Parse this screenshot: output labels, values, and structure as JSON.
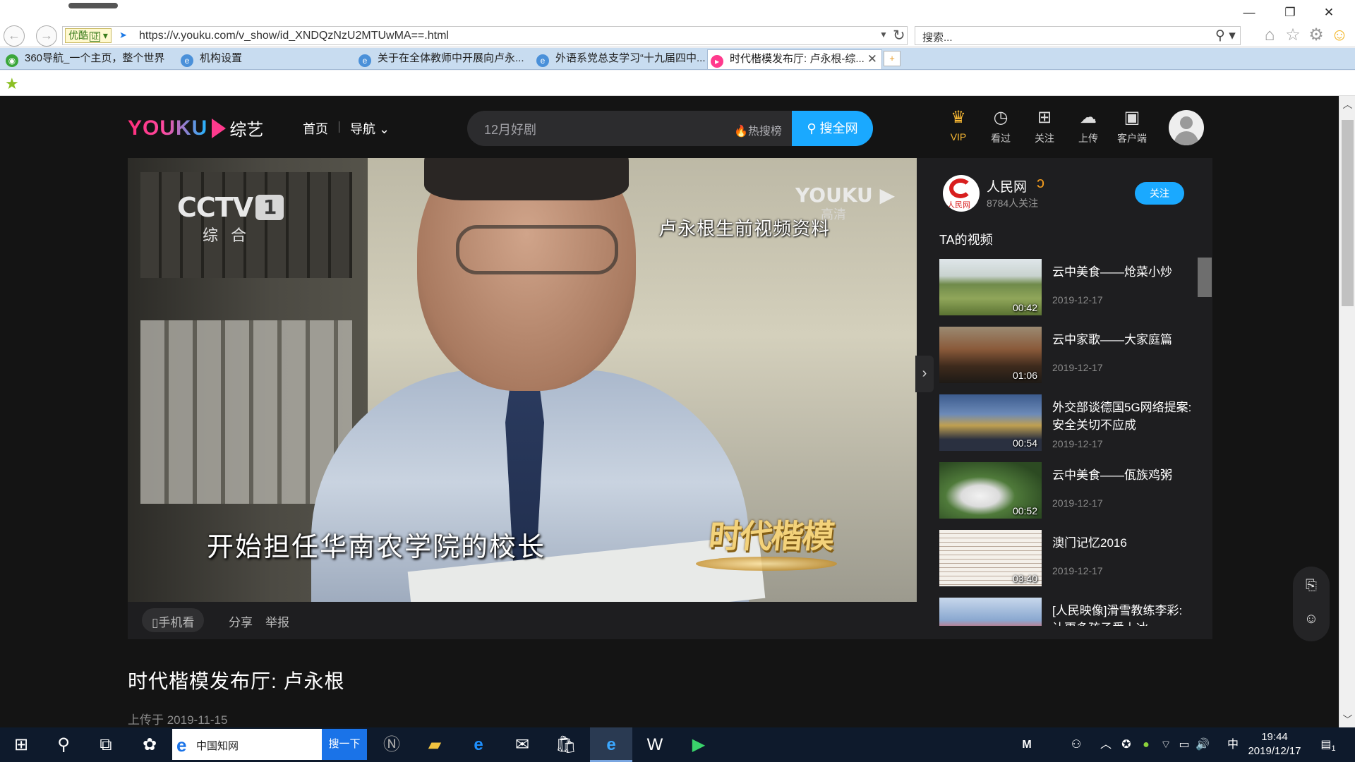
{
  "browser": {
    "url": "https://v.youku.com/v_show/id_XNDQzNzU2MTUwMA==.html",
    "cert_label": "优酷",
    "cert_mark": "证",
    "search_placeholder": "搜索...",
    "tabs": [
      {
        "label": "360导航_一个主页，整个世界",
        "active": false
      },
      {
        "label": "机构设置",
        "active": false
      },
      {
        "label": "关于在全体教师中开展向卢永...",
        "active": false
      },
      {
        "label": "外语系党总支学习“十九届四中...",
        "active": false
      },
      {
        "label": "时代楷模发布厅: 卢永根-综...",
        "active": true
      }
    ],
    "window_controls": {
      "minimize": "—",
      "maximize": "❐",
      "close": "✕"
    }
  },
  "youku": {
    "brand_word": "YOUKU",
    "category": "综艺",
    "nav": {
      "home": "首页",
      "guide": "导航"
    },
    "search": {
      "query": "12月好剧",
      "hot_label": "热搜榜",
      "button": "搜全网"
    },
    "user_icons": [
      {
        "label": "VIP",
        "icon": "crown-icon",
        "glyph": "♛"
      },
      {
        "label": "看过",
        "icon": "clock-icon",
        "glyph": "◷"
      },
      {
        "label": "关注",
        "icon": "bookmark-plus-icon",
        "glyph": "⊞"
      },
      {
        "label": "上传",
        "icon": "upload-cloud-icon",
        "glyph": "☁"
      },
      {
        "label": "客户端",
        "icon": "client-app-icon",
        "glyph": "▣"
      }
    ],
    "accent_color": "#1aa9ff"
  },
  "video": {
    "channel_logo": "CCTV",
    "channel_number": "1",
    "channel_sub": "综合",
    "watermark": "YOUKU",
    "watermark_sub": "高清",
    "caption_top": "卢永根生前视频资料",
    "subtitle": "开始担任华南农学院的校长",
    "program_badge": "时代楷模",
    "actions": {
      "phone": "手机看",
      "share": "分享",
      "report": "举报"
    }
  },
  "channel": {
    "name": "人民网",
    "avatar_text": "人民网",
    "fans": "8784人关注",
    "follow_button": "关注",
    "section_title": "TA的视频",
    "videos": [
      {
        "title": "云中美食——炝菜小炒",
        "duration": "00:42",
        "date": "2019-12-17"
      },
      {
        "title": "云中家歌——大家庭篇",
        "duration": "01:06",
        "date": "2019-12-17"
      },
      {
        "title": "外交部谈德国5G网络提案: 安全关切不应成",
        "duration": "00:54",
        "date": "2019-12-17"
      },
      {
        "title": "云中美食——佤族鸡粥",
        "duration": "00:52",
        "date": "2019-12-17"
      },
      {
        "title": "澳门记忆2016",
        "duration": "03:40",
        "date": "2019-12-17"
      },
      {
        "title": "[人民映像]滑雪教练李彩: 让更多孩子爱上冰",
        "duration": "",
        "date": ""
      }
    ]
  },
  "page": {
    "title": "时代楷模发布厅: 卢永根",
    "upload_date": "上传于 2019-11-15"
  },
  "taskbar": {
    "search_text": "中国知网",
    "search_button": "搜一下",
    "ime": "中",
    "time": "19:44",
    "date": "2019/12/17",
    "notification_count": "1"
  }
}
